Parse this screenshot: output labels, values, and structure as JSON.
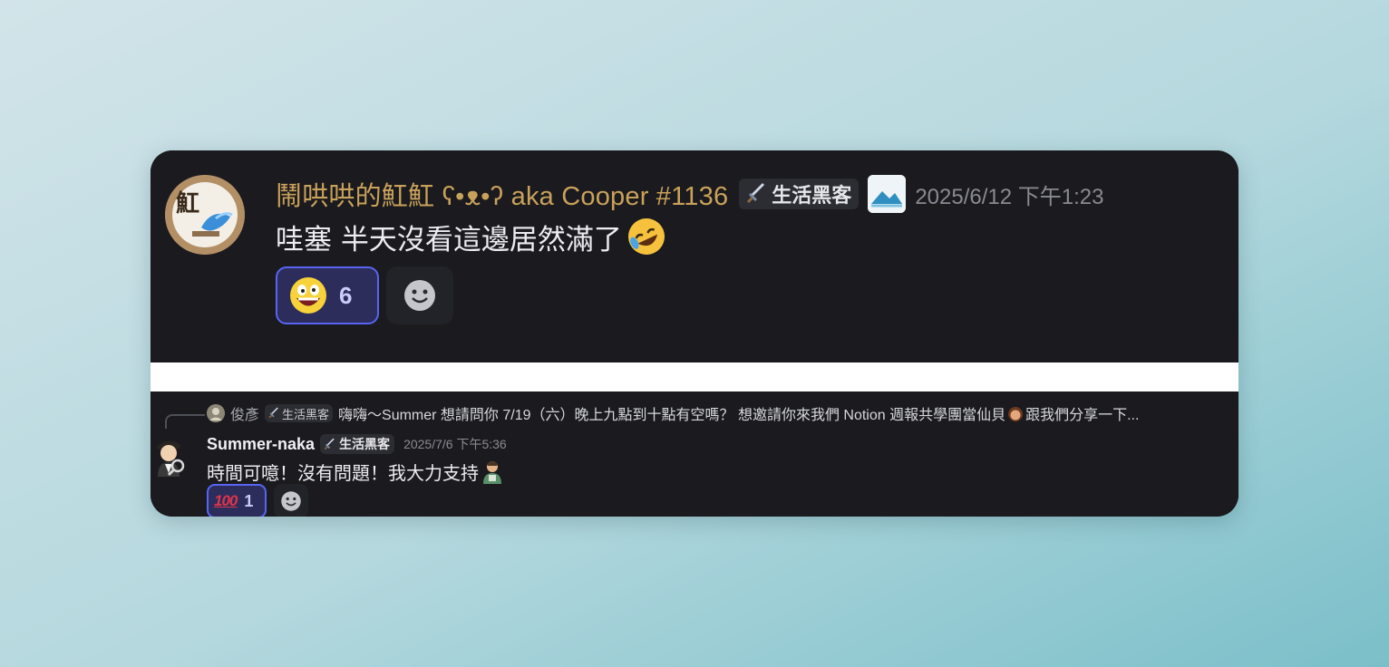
{
  "background": {
    "color_top": "#cfe3e8",
    "color_bottom": "#7fc0ca"
  },
  "message1": {
    "avatar_icon": "crab-avatar-icon",
    "avatar_text": "虹",
    "username": "鬧哄哄的魟魟 ʕ•ᴥ•ʔ aka Cooper #1136",
    "username_color": "#c9a25a",
    "role_label": "生活黑客",
    "image_icon": "image-icon",
    "timestamp": "2025/6/12 下午1:23",
    "content": "哇塞 半天沒看這邊居然滿了",
    "content_emoji": "rofl-emoji-icon",
    "reactions": [
      {
        "emoji": "grinning-face-emoji-icon",
        "count": "6",
        "active": true
      }
    ],
    "add_reaction_icon": "add-reaction-icon"
  },
  "message2": {
    "reply": {
      "avatar_icon": "reply-avatar-icon",
      "name": "俊彥",
      "role_label": "生活黑客",
      "text": "嗨嗨～Summer  想請問你 7/19（六）晚上九點到十點有空嗎？  想邀請你來我們 Notion 週報共學團當仙貝",
      "text_tail": "跟我們分享一下..."
    },
    "avatar_icon": "detective-avatar-icon",
    "username": "Summer-naka",
    "role_label": "生活黑客",
    "timestamp": "2025/7/6 下午5:36",
    "content": "時間可噫！沒有問題！我大力支持",
    "content_emoji": "person-emoji-icon",
    "reactions": [
      {
        "emoji": "hundred-points-emoji-icon",
        "emoji_text": "100",
        "count": "1",
        "active": true
      }
    ],
    "add_reaction_icon": "add-reaction-icon"
  },
  "colors": {
    "card_bg": "#1a1a1f",
    "reaction_active_bg": "#2c2d5a",
    "reaction_active_border": "#5865f2",
    "timestamp": "#8a8b92"
  }
}
